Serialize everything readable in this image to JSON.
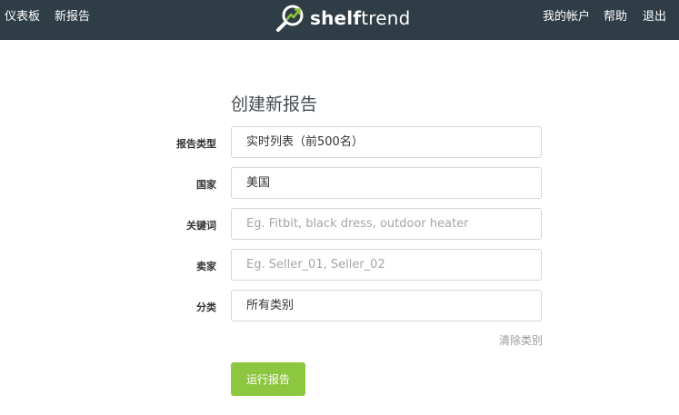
{
  "nav": {
    "left": [
      {
        "label": "仪表板"
      },
      {
        "label": "新报告"
      }
    ],
    "right": [
      {
        "label": "我的帐户"
      },
      {
        "label": "帮助"
      },
      {
        "label": "退出"
      }
    ],
    "logo": {
      "bold": "shelf",
      "light": "trend",
      "icon": "magnifier-trend-icon",
      "icon_accent": "#8dc63f"
    }
  },
  "form": {
    "title": "创建新报告",
    "fields": {
      "report_type": {
        "label": "报告类型",
        "value": "实时列表（前500名）"
      },
      "country": {
        "label": "国家",
        "value": "美国"
      },
      "keywords": {
        "label": "关键词",
        "value": "",
        "placeholder": "Eg. Fitbit, black dress, outdoor heater"
      },
      "seller": {
        "label": "卖家",
        "value": "",
        "placeholder": "Eg. Seller_01, Seller_02"
      },
      "category": {
        "label": "分类",
        "value": "所有类别"
      }
    },
    "clear_categories": "清除类别",
    "run_button": "运行报告"
  },
  "colors": {
    "topbar": "#2f3e46",
    "accent": "#8dc63f",
    "muted_text": "#9a9a9a"
  }
}
